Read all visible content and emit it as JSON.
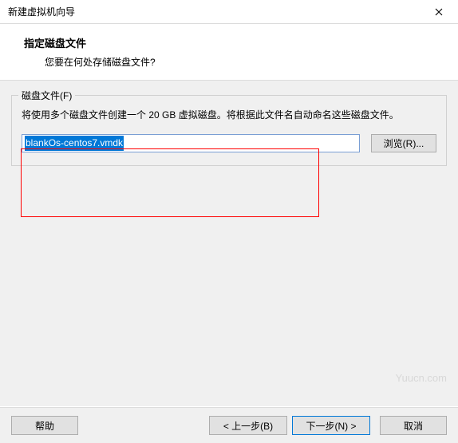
{
  "titlebar": {
    "title": "新建虚拟机向导"
  },
  "header": {
    "title": "指定磁盘文件",
    "subtitle": "您要在何处存储磁盘文件?"
  },
  "fieldset": {
    "legend": "磁盘文件(F)",
    "description": "将使用多个磁盘文件创建一个 20 GB 虚拟磁盘。将根据此文件名自动命名这些磁盘文件。",
    "input_value": "blankOs-centos7.vmdk",
    "browse_label": "浏览(R)..."
  },
  "watermark": "Yuucn.com",
  "footer": {
    "help": "帮助",
    "back": "< 上一步(B)",
    "next": "下一步(N) >",
    "cancel": "取消"
  }
}
